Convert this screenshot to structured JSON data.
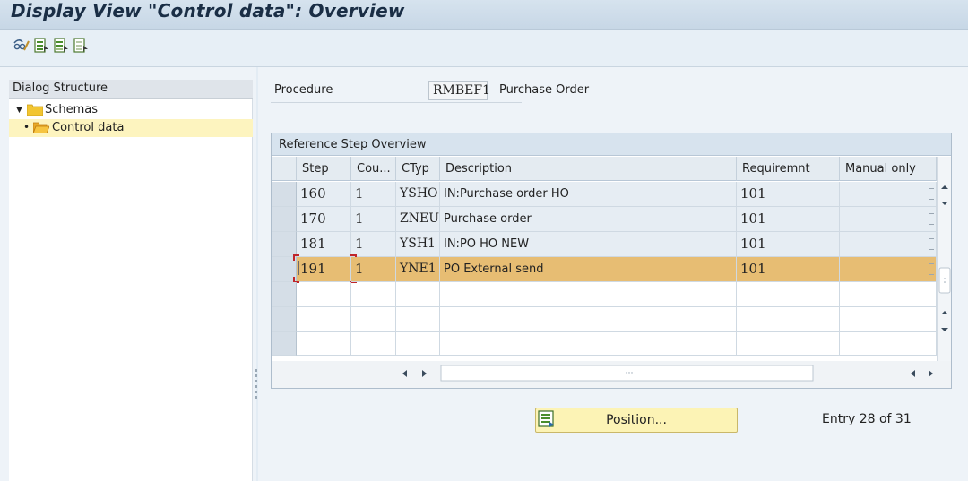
{
  "window": {
    "title": "Display View \"Control data\": Overview"
  },
  "toolbar": {
    "buttons": [
      {
        "name": "other-view-icon"
      },
      {
        "name": "select-all-icon"
      },
      {
        "name": "select-block-icon"
      },
      {
        "name": "deselect-all-icon"
      }
    ]
  },
  "dialog_structure": {
    "header": "Dialog Structure",
    "items": [
      {
        "label": "Schemas",
        "expanded": true
      },
      {
        "label": "Control data",
        "selected": true
      }
    ]
  },
  "procedure": {
    "label": "Procedure",
    "value": "RMBEF1",
    "description": "Purchase Order"
  },
  "table": {
    "caption": "Reference Step Overview",
    "columns": [
      "Step",
      "Cou...",
      "CTyp",
      "Description",
      "Requiremnt",
      "Manual only"
    ],
    "rows": [
      {
        "step": "160",
        "counter": "1",
        "ctyp": "YSHO",
        "description": "IN:Purchase order HO",
        "requirement": "101"
      },
      {
        "step": "170",
        "counter": "1",
        "ctyp": "ZNEU",
        "description": "Purchase order",
        "requirement": "101"
      },
      {
        "step": "181",
        "counter": "1",
        "ctyp": "YSH1",
        "description": "IN:PO HO NEW",
        "requirement": "101"
      },
      {
        "step": "191",
        "counter": "1",
        "ctyp": "YNE1",
        "description": "PO External send",
        "requirement": "101",
        "highlighted": true
      }
    ],
    "colors": {
      "highlight": "#e7bd73",
      "row": "#e6edf3"
    }
  },
  "footer": {
    "position_button": "Position...",
    "entry": "Entry 28 of 31"
  }
}
